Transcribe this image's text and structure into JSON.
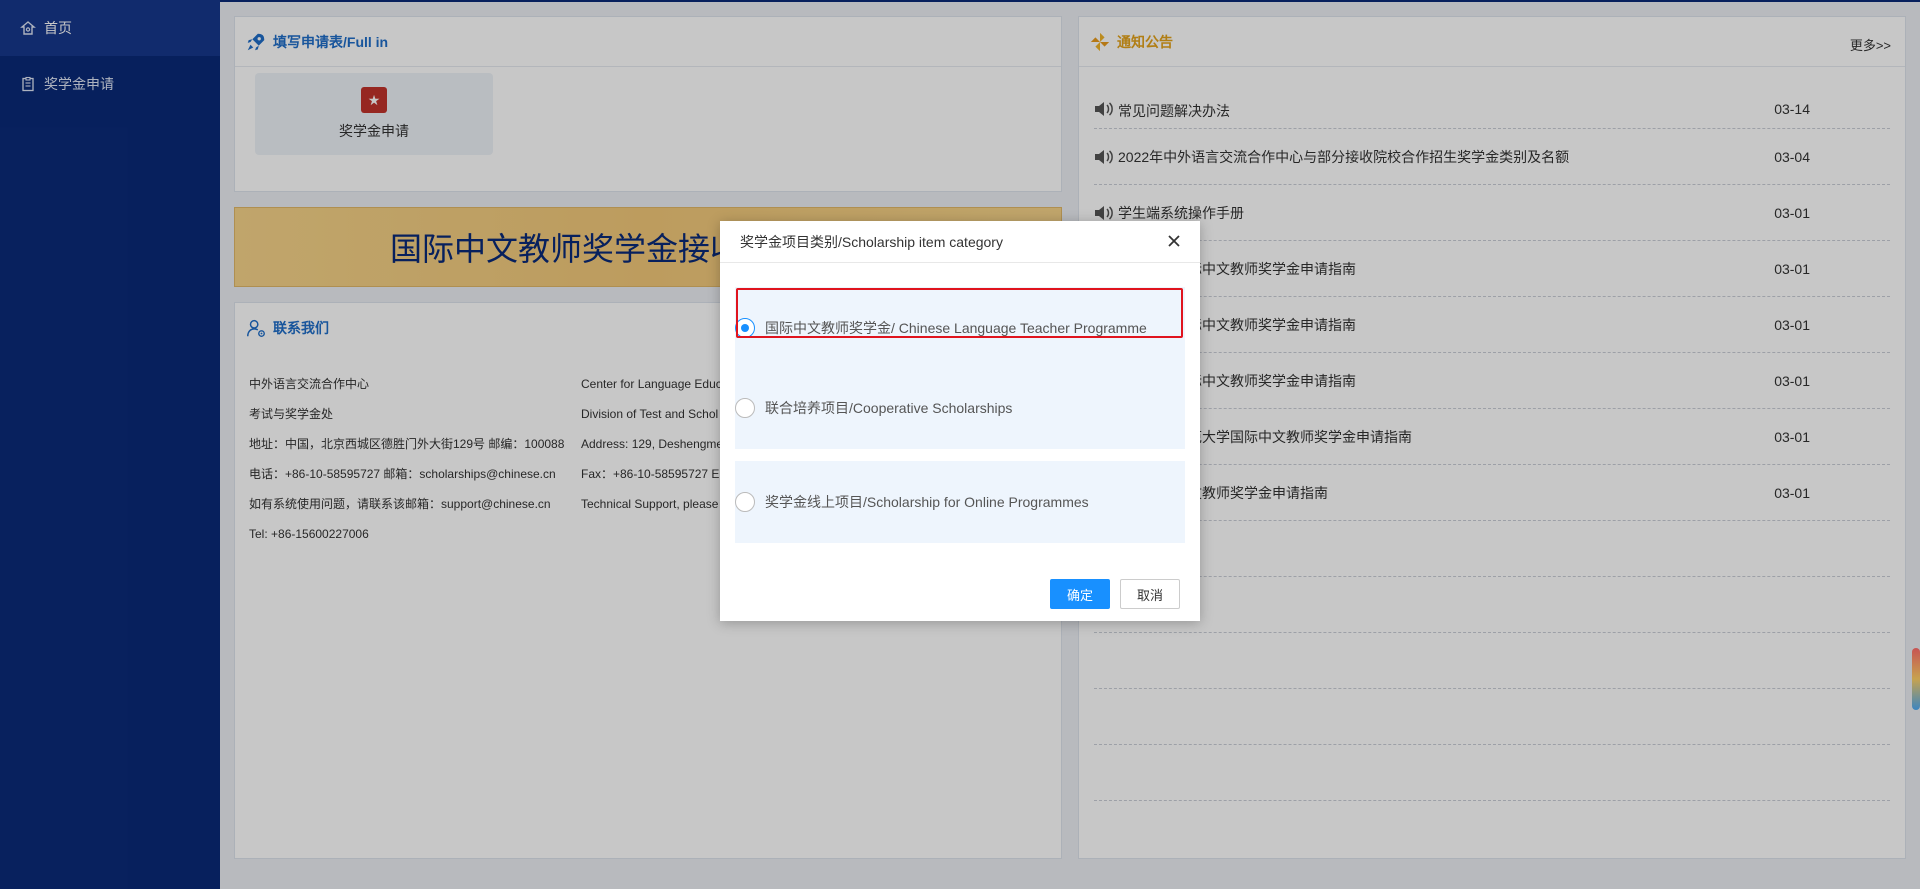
{
  "sidebar": {
    "items": [
      {
        "label": "首页",
        "icon": "home-icon",
        "active": true
      },
      {
        "label": "奖学金申请",
        "icon": "clipboard-icon",
        "active": false
      }
    ]
  },
  "apply_panel": {
    "title": "填写申请表/Full in",
    "card_label": "奖学金申请"
  },
  "banner": {
    "text": "国际中文教师奖学金接收"
  },
  "contact": {
    "title": "联系我们",
    "left_lines": [
      "中外语言交流合作中心",
      "考试与奖学金处",
      "地址：中国，北京西城区德胜门外大街129号 邮编：100088",
      "电话：+86-10-58595727 邮箱：scholarships@chinese.cn",
      "如有系统使用问题，请联系该邮箱：support@chinese.cn",
      "Tel: +86-15600227006"
    ],
    "right_lines": [
      "Center for Language Educ",
      "Division of Test and Schol",
      "Address: 129, Deshengme",
      "Fax：+86-10-58595727 E",
      "Technical Support, please"
    ]
  },
  "notice": {
    "title": "通知公告",
    "more_label": "更多>>",
    "items": [
      {
        "text": "常见问题解决办法",
        "date": "03-14"
      },
      {
        "text": "2022年中外语言交流合作中心与部分接收院校合作招生奖学金类别及名额",
        "date": "03-04"
      },
      {
        "text": "学生端系统操作手册",
        "date": "03-01"
      },
      {
        "text": "财经大学国际中文教师奖学金申请指南",
        "date": "03-01"
      },
      {
        "text": "农林大学国际中文教师奖学金申请指南",
        "date": "03-01"
      },
      {
        "text": "理工大学国际中文教师奖学金申请指南",
        "date": "03-01"
      },
      {
        "text": "职业技术师范大学国际中文教师奖学金申请指南",
        "date": "03-01"
      },
      {
        "text": "大学国际中文教师奖学金申请指南",
        "date": "03-01"
      },
      {
        "text": "",
        "date": ""
      },
      {
        "text": "",
        "date": ""
      },
      {
        "text": "",
        "date": ""
      },
      {
        "text": "",
        "date": ""
      },
      {
        "text": "",
        "date": ""
      }
    ]
  },
  "dialog": {
    "title": "奖学金项目类别/Scholarship item category",
    "options": [
      {
        "label": "国际中文教师奖学金/ Chinese Language Teacher Programme",
        "checked": true
      },
      {
        "label": "联合培养项目/Cooperative Scholarships",
        "checked": false
      },
      {
        "label": "奖学金线上项目/Scholarship for Online Programmes",
        "checked": false
      }
    ],
    "confirm_label": "确定",
    "cancel_label": "取消"
  },
  "colors": {
    "sidebar_bg": "#0a2a78",
    "accent": "#1890ff",
    "highlight": "#e0141e",
    "banner_gold": "#f2c879"
  }
}
